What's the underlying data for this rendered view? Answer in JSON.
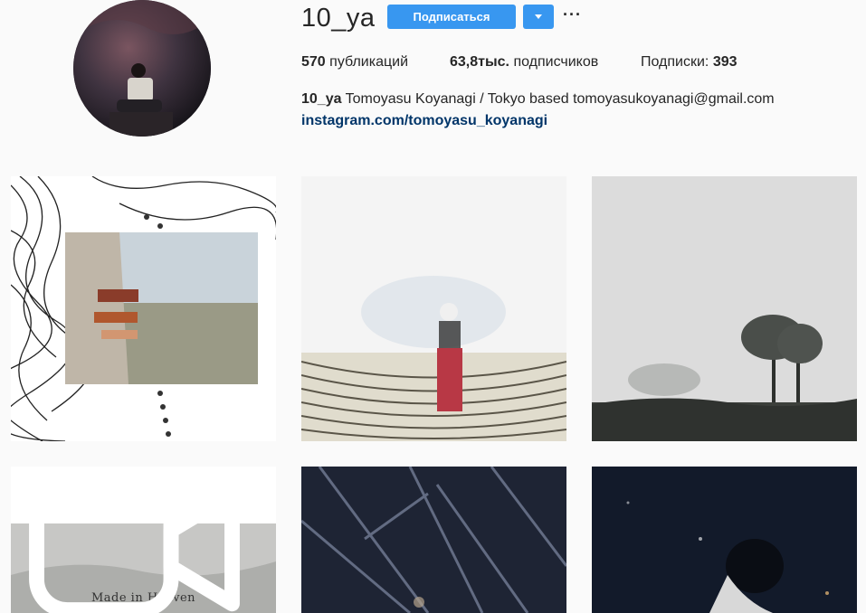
{
  "profile": {
    "username": "10_ya",
    "follow_label": "Подписаться",
    "more_label": "···"
  },
  "stats": {
    "posts_count": "570",
    "posts_label": "публикаций",
    "followers_count": "63,8тыс.",
    "followers_label": "подписчиков",
    "following_label": "Подписки:",
    "following_count": "393"
  },
  "bio": {
    "name": "10_ya",
    "text": "Tomoyasu Koyanagi / Tokyo based tomoyasukoyanagi@gmail.com",
    "link": "instagram.com/tomoyasu_koyanagi"
  },
  "posts": [
    {
      "caption": ""
    },
    {
      "caption": ""
    },
    {
      "caption": ""
    },
    {
      "caption": "Made in Heaven",
      "video": true
    },
    {
      "caption": ""
    },
    {
      "caption": ""
    }
  ],
  "icons": {
    "dropdown": "chevron-down-icon",
    "more": "ellipsis-icon",
    "video": "video-camera-icon"
  },
  "colors": {
    "accent": "#3897f0",
    "link": "#003569",
    "background": "#fafafa"
  }
}
